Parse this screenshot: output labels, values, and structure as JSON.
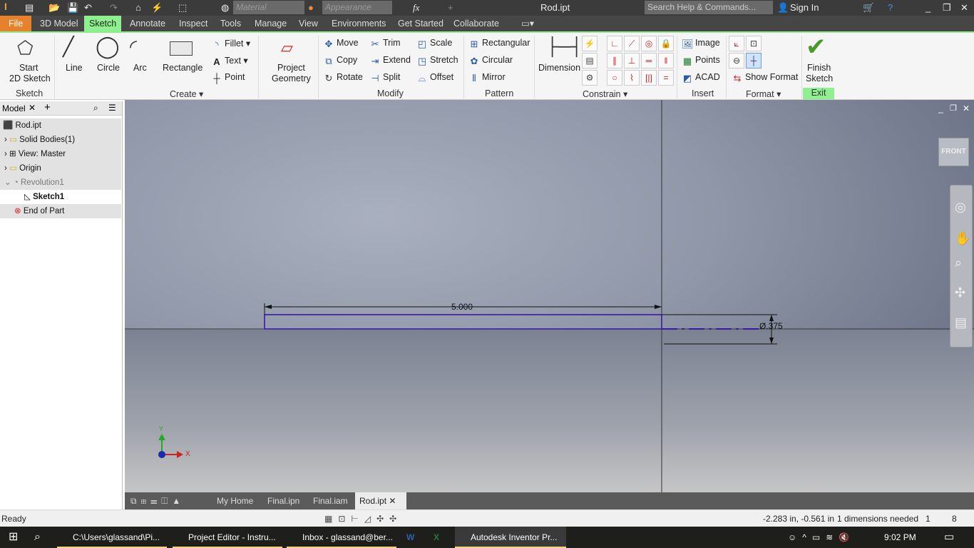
{
  "title_bar": {
    "app_badge": "PRO",
    "material_placeholder": "Material",
    "appearance_placeholder": "Appearance",
    "fx_label": "fx",
    "document_title": "Rod.ipt",
    "search_placeholder": "Search Help & Commands...",
    "sign_in": "Sign In"
  },
  "ribbon_tabs": [
    "File",
    "3D Model",
    "Sketch",
    "Annotate",
    "Inspect",
    "Tools",
    "Manage",
    "View",
    "Environments",
    "Get Started",
    "Collaborate"
  ],
  "active_tab": "Sketch",
  "accent": "#8ff08f",
  "file_color": "#e8822a",
  "ribbon": {
    "sketch": {
      "start_line1": "Start",
      "start_line2": "2D Sketch",
      "group": "Sketch"
    },
    "create": {
      "line": "Line",
      "circle": "Circle",
      "arc": "Arc",
      "rectangle": "Rectangle",
      "fillet": "Fillet",
      "text": "Text",
      "point": "Point",
      "group": "Create"
    },
    "project": {
      "line1": "Project",
      "line2": "Geometry"
    },
    "modify": {
      "move": "Move",
      "copy": "Copy",
      "rotate": "Rotate",
      "trim": "Trim",
      "extend": "Extend",
      "split": "Split",
      "scale": "Scale",
      "stretch": "Stretch",
      "offset": "Offset",
      "group": "Modify"
    },
    "pattern": {
      "rectangular": "Rectangular",
      "circular": "Circular",
      "mirror": "Mirror",
      "group": "Pattern"
    },
    "constrain": {
      "dimension": "Dimension",
      "group": "Constrain"
    },
    "insert": {
      "image": "Image",
      "points": "Points",
      "acad": "ACAD",
      "group": "Insert"
    },
    "format": {
      "show_format": "Show Format",
      "group": "Format"
    },
    "exit": {
      "line1": "Finish",
      "line2": "Sketch",
      "group": "Exit"
    }
  },
  "browser": {
    "tab": "Model",
    "nodes": [
      {
        "label": "Rod.ipt",
        "icon": "part-icon"
      },
      {
        "label": "Solid Bodies(1)",
        "icon": "folder-icon"
      },
      {
        "label": "View: Master",
        "icon": "view-icon"
      },
      {
        "label": "Origin",
        "icon": "folder-icon"
      },
      {
        "label": "Revolution1",
        "icon": "revolve-icon"
      },
      {
        "label": "Sketch1",
        "icon": "sketch-icon"
      },
      {
        "label": "End of Part",
        "icon": "end-of-part-icon"
      }
    ]
  },
  "viewport": {
    "viewcube": "FRONT",
    "dimension_length": "5.000",
    "dimension_diameter": "Ø.375",
    "axis_x": "X",
    "axis_y": "Y"
  },
  "doc_tabs": [
    "My Home",
    "Final.ipn",
    "Final.iam",
    "Rod.ipt"
  ],
  "active_doc": "Rod.ipt",
  "status": {
    "text": "Ready",
    "coords": "-2.283 in, -0.561 in",
    "dims_needed": "1 dimensions needed",
    "count1": "1",
    "count2": "8"
  },
  "taskbar": {
    "items": [
      "C:\\Users\\glassand\\Pi...",
      "Project Editor - Instru...",
      "Inbox - glassand@ber...",
      "",
      "",
      "Autodesk Inventor Pr..."
    ],
    "time": "9:02 PM"
  }
}
